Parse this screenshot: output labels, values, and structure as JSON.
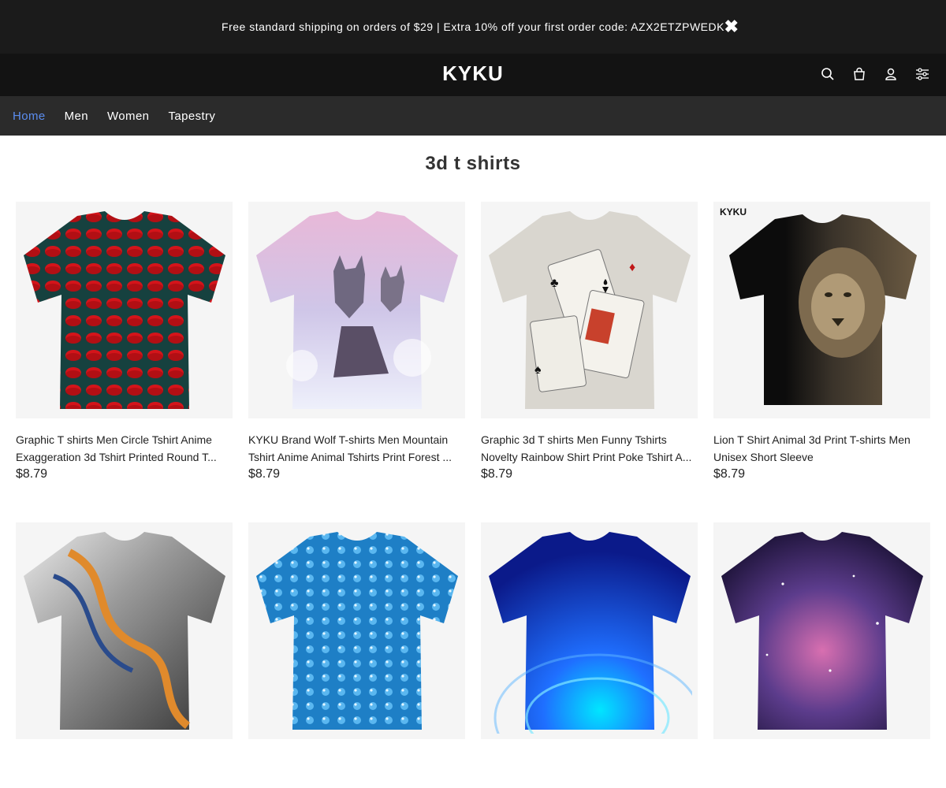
{
  "announcement": {
    "text": "Free standard shipping on orders of $29 | Extra 10% off your first order code: AZX2ETZPWEDK",
    "close_glyph": "✖"
  },
  "header": {
    "logo": "KYKU",
    "icons": [
      "search-icon",
      "shopping-bag-icon",
      "user-icon",
      "filter-sliders-icon"
    ]
  },
  "nav": {
    "items": [
      "Home",
      "Men",
      "Women",
      "Tapestry"
    ],
    "active": "Home"
  },
  "page": {
    "title": "3d t shirts"
  },
  "colors": {
    "accent": "#5b8def",
    "announce_bg": "#1b1b1b",
    "header_bg": "#131313",
    "nav_bg": "#2b2b2b"
  },
  "products": [
    {
      "title": "Graphic T shirts Men Circle Tshirt Anime Exaggeration 3d Tshirt Printed Round T...",
      "price": "$8.79",
      "image": "red-circles-tshirt"
    },
    {
      "title": "KYKU Brand Wolf T-shirts Men Mountain Tshirt Anime Animal Tshirts Print Forest ...",
      "price": "$8.79",
      "image": "wolf-tshirt"
    },
    {
      "title": "Graphic 3d T shirts Men Funny Tshirts Novelty Rainbow Shirt Print Poke Tshirt A...",
      "price": "$8.79",
      "image": "poker-cards-tshirt"
    },
    {
      "title": "Lion T Shirt Animal 3d Print T-shirts Men Unisex Short Sleeve",
      "price": "$8.79",
      "image": "lion-tshirt",
      "brand_mark": "KYKU"
    },
    {
      "title": "",
      "price": "",
      "image": "abstract-swirl-tshirt"
    },
    {
      "title": "",
      "price": "",
      "image": "water-drops-tshirt"
    },
    {
      "title": "",
      "price": "",
      "image": "blue-tunnel-tshirt"
    },
    {
      "title": "",
      "price": "",
      "image": "galaxy-tshirt"
    }
  ]
}
